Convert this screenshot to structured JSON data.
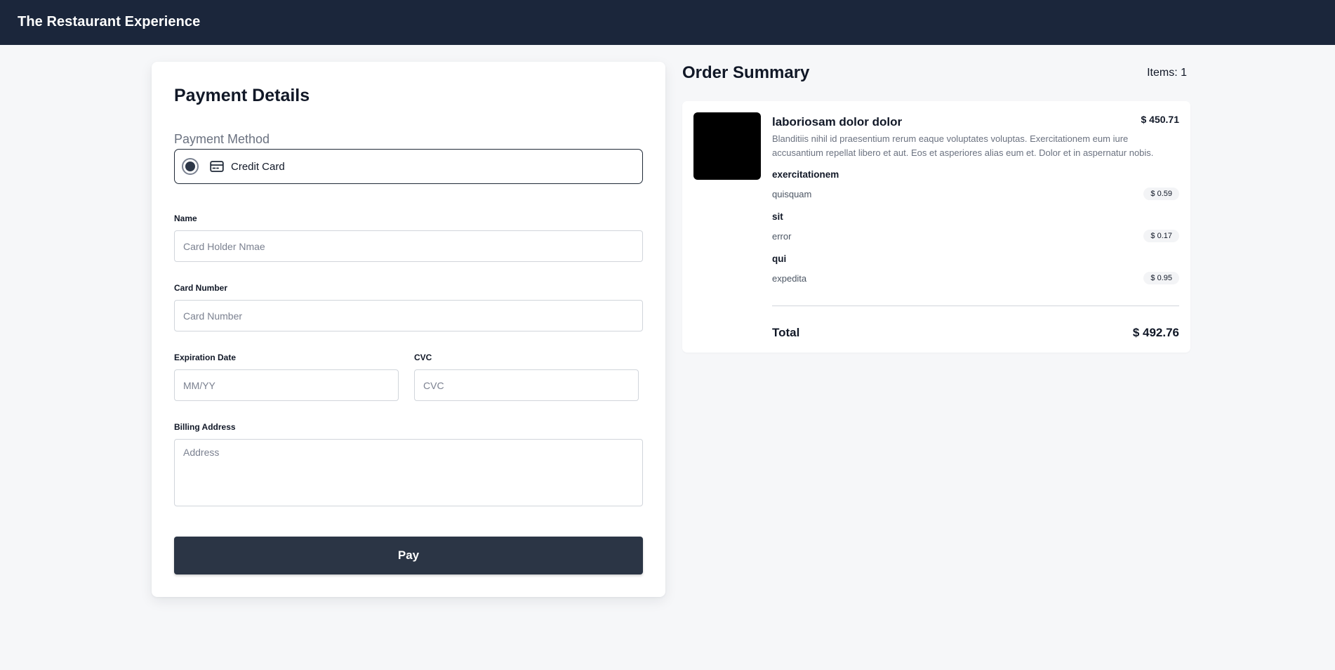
{
  "header": {
    "title": "The Restaurant Experience"
  },
  "payment": {
    "title": "Payment Details",
    "method_label": "Payment Method",
    "method_option": "Credit Card",
    "name_label": "Name",
    "name_placeholder": "Card Holder Nmae",
    "card_number_label": "Card Number",
    "card_number_placeholder": "Card Number",
    "expiration_label": "Expiration Date",
    "expiration_placeholder": "MM/YY",
    "cvc_label": "CVC",
    "cvc_placeholder": "CVC",
    "billing_label": "Billing Address",
    "billing_placeholder": "Address",
    "pay_button": "Pay"
  },
  "summary": {
    "title": "Order Summary",
    "items_count": "Items: 1",
    "item": {
      "name": "laboriosam dolor dolor",
      "price": "$ 450.71",
      "description": "Blanditiis nihil id praesentium rerum eaque voluptates voluptas. Exercitationem eum iure accusantium repellat libero et aut. Eos et asperiores alias eum et. Dolor et in aspernatur nobis.",
      "option_groups": [
        {
          "title": "exercitationem",
          "option": "quisquam",
          "price": "$ 0.59"
        },
        {
          "title": "sit",
          "option": "error",
          "price": "$ 0.17"
        },
        {
          "title": "qui",
          "option": "expedita",
          "price": "$ 0.95"
        }
      ]
    },
    "total_label": "Total",
    "total_value": "$ 492.76"
  }
}
